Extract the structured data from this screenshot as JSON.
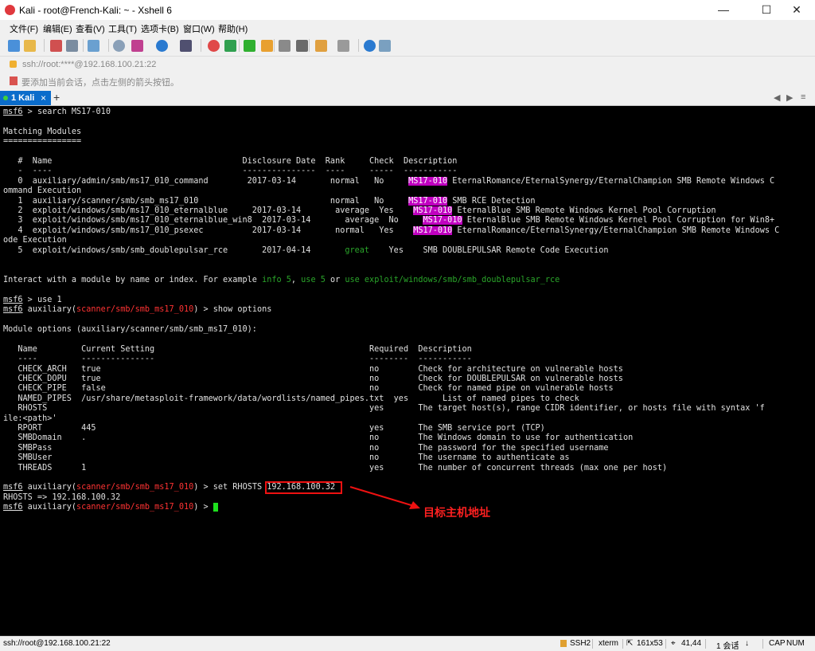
{
  "window": {
    "title": "Kali - root@French-Kali: ~ - Xshell 6",
    "min": "—",
    "max": "☐",
    "close": "✕"
  },
  "menu": [
    "文件(F)",
    "编辑(E)",
    "查看(V)",
    "工具(T)",
    "选项卡(B)",
    "窗口(W)",
    "帮助(H)"
  ],
  "address": "ssh://root:****@192.168.100.21:22",
  "tip": "要添加当前会话，点击左侧的箭头按钮。",
  "tab": {
    "label": "1 Kali",
    "close": "×",
    "add": "+",
    "prev": "◀",
    "next": "▶",
    "list": "≡"
  },
  "terminal": {
    "prompt": "msf6",
    "cmd_search": " > search MS17-010",
    "matching_title": "Matching Modules",
    "matching_rule": "================",
    "mod_header": "   #  Name                                       Disclosure Date  Rank     Check  Description",
    "mod_rule": "   -  ----                                       ---------------  ----     -----  -----------",
    "highlight": "MS17-010",
    "modules": [
      {
        "pre": "   0  auxiliary/admin/smb/ms17_010_command        2017-03-14       normal   No     ",
        "desc": " EternalRomance/EternalSynergy/EternalChampion SMB Remote Windows C"
      },
      {
        "pre": "   1  auxiliary/scanner/smb/smb_ms17_010                           normal   No     ",
        "desc": " SMB RCE Detection"
      },
      {
        "pre": "   2  exploit/windows/smb/ms17_010_eternalblue     2017-03-14       average  Yes    ",
        "desc": " EternalBlue SMB Remote Windows Kernel Pool Corruption"
      },
      {
        "pre": "   3  exploit/windows/smb/ms17_010_eternalblue_win8  2017-03-14       average  No     ",
        "desc": " EternalBlue SMB Remote Windows Kernel Pool Corruption for Win8+"
      },
      {
        "pre": "   4  exploit/windows/smb/ms17_010_psexec          2017-03-14       normal   Yes    ",
        "desc": " EternalRomance/EternalSynergy/EternalChampion SMB Remote Windows C"
      }
    ],
    "wrap0": "ommand Execution",
    "wrap4": "ode Execution",
    "mod5_a": "   5  exploit/windows/smb/smb_doublepulsar_rce       2017-04-14       ",
    "mod5_rank": "great",
    "mod5_b": "    Yes    SMB DOUBLEPULSAR Remote Code Execution",
    "interact_a": "Interact with a module by name or index. For example ",
    "interact_g1": "info 5",
    "interact_c1": ", ",
    "interact_g2": "use 5",
    "interact_c2": " or ",
    "interact_g3": "use exploit/windows/smb/smb_doublepulsar_rce",
    "cmd_use": " > use 1",
    "aux_word": " auxiliary(",
    "aux_module": "scanner/smb/smb_ms17_010",
    "aux_close": ") > ",
    "cmd_show": "show options",
    "opts_title": "Module options (auxiliary/scanner/smb/smb_ms17_010):",
    "opt_header": "   Name         Current Setting                                            Required  Description",
    "opt_rule": "   ----         ---------------                                            --------  -----------",
    "options": [
      "   CHECK_ARCH   true                                                       no        Check for architecture on vulnerable hosts",
      "   CHECK_DOPU   true                                                       no        Check for DOUBLEPULSAR on vulnerable hosts",
      "   CHECK_PIPE   false                                                      no        Check for named pipe on vulnerable hosts",
      "   NAMED_PIPES  /usr/share/metasploit-framework/data/wordlists/named_pipes.txt  yes       List of named pipes to check",
      "   RHOSTS                                                                  yes       The target host(s), range CIDR identifier, or hosts file with syntax 'f",
      "ile:<path>'",
      "   RPORT        445                                                        yes       The SMB service port (TCP)",
      "   SMBDomain    .                                                          no        The Windows domain to use for authentication",
      "   SMBPass                                                                 no        The password for the specified username",
      "   SMBUser                                                                 no        The username to authenticate as",
      "   THREADS      1                                                          yes       The number of concurrent threads (max one per host)"
    ],
    "cmd_set": "set RHOSTS ",
    "set_ip": "192.168.100.32",
    "rhosts_out": "RHOSTS => 192.168.100.32"
  },
  "annotation": "目标主机地址",
  "status": {
    "conn": "ssh://root@192.168.100.21:22",
    "proto": "SSH2",
    "term": "xterm",
    "size": "161x53",
    "pos": "41,44",
    "sessions": "1 会话",
    "caps": "CAP",
    "num": "NUM"
  }
}
